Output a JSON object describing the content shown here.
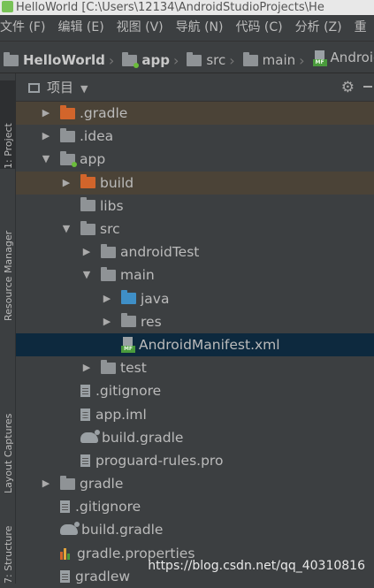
{
  "title": "HelloWorld [C:\\Users\\12134\\AndroidStudioProjects\\He",
  "menu": [
    "文件 (F)",
    "编辑 (E)",
    "视图 (V)",
    "导航 (N)",
    "代码 (C)",
    "分析 (Z)",
    "重"
  ],
  "breadcrumb": [
    "HelloWorld",
    "app",
    "src",
    "main",
    "AndroidM"
  ],
  "side_tabs": [
    "1: Project",
    "Resource Manager",
    "Layout Captures",
    "7: Structure"
  ],
  "panel": {
    "view_label": "项目"
  },
  "tree": [
    {
      "label": ".gradle",
      "indent": 0,
      "arrow": "right",
      "icon": "folder-orange",
      "highlight": "brown"
    },
    {
      "label": ".idea",
      "indent": 0,
      "arrow": "right",
      "icon": "folder"
    },
    {
      "label": "app",
      "indent": 0,
      "arrow": "down",
      "icon": "folder-module"
    },
    {
      "label": "build",
      "indent": 1,
      "arrow": "right",
      "icon": "folder-orange",
      "highlight": "brown"
    },
    {
      "label": "libs",
      "indent": 1,
      "arrow": "none",
      "icon": "folder"
    },
    {
      "label": "src",
      "indent": 1,
      "arrow": "down",
      "icon": "folder"
    },
    {
      "label": "androidTest",
      "indent": 2,
      "arrow": "right",
      "icon": "folder"
    },
    {
      "label": "main",
      "indent": 2,
      "arrow": "down",
      "icon": "folder"
    },
    {
      "label": "java",
      "indent": 3,
      "arrow": "right",
      "icon": "folder-blue"
    },
    {
      "label": "res",
      "indent": 3,
      "arrow": "right",
      "icon": "folder-res"
    },
    {
      "label": "AndroidManifest.xml",
      "indent": 3,
      "arrow": "none",
      "icon": "manifest",
      "highlight": "selected"
    },
    {
      "label": "test",
      "indent": 2,
      "arrow": "right",
      "icon": "folder"
    },
    {
      "label": ".gitignore",
      "indent": 1,
      "arrow": "none",
      "icon": "file"
    },
    {
      "label": "app.iml",
      "indent": 1,
      "arrow": "none",
      "icon": "module-file"
    },
    {
      "label": "build.gradle",
      "indent": 1,
      "arrow": "none",
      "icon": "gradle"
    },
    {
      "label": "proguard-rules.pro",
      "indent": 1,
      "arrow": "none",
      "icon": "file"
    },
    {
      "label": "gradle",
      "indent": 0,
      "arrow": "right",
      "icon": "folder"
    },
    {
      "label": ".gitignore",
      "indent": 0,
      "arrow": "none",
      "icon": "file"
    },
    {
      "label": "build.gradle",
      "indent": 0,
      "arrow": "none",
      "icon": "gradle"
    },
    {
      "label": "gradle.properties",
      "indent": 0,
      "arrow": "none",
      "icon": "properties"
    },
    {
      "label": "gradlew",
      "indent": 0,
      "arrow": "none",
      "icon": "file"
    }
  ],
  "watermark": "https://blog.csdn.net/qq_40310816"
}
